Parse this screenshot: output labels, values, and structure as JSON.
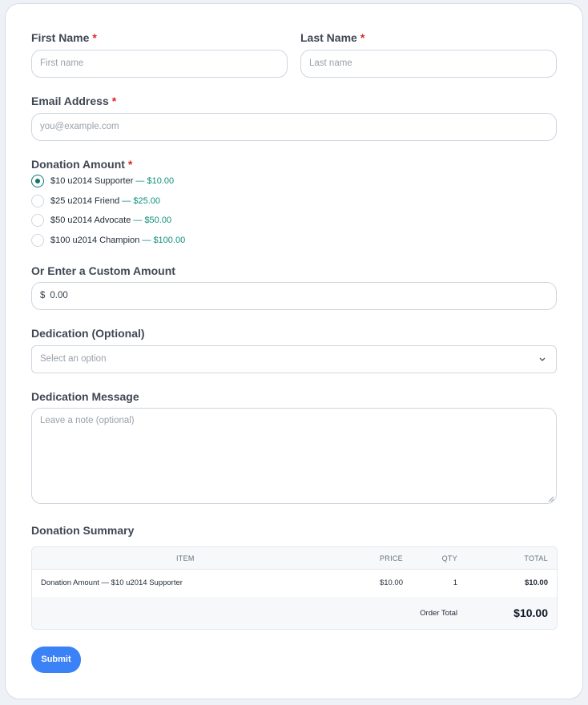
{
  "form": {
    "first_name": {
      "label": "First Name",
      "required_mark": "*",
      "placeholder": "First name"
    },
    "last_name": {
      "label": "Last Name",
      "required_mark": "*",
      "placeholder": "Last name"
    },
    "email": {
      "label": "Email Address",
      "required_mark": "*",
      "placeholder": "you@example.com"
    },
    "donation": {
      "label": "Donation Amount",
      "required_mark": "*",
      "options": [
        {
          "text": "$10 u2014 Supporter",
          "sep": " — ",
          "amount": "$10.00",
          "checked": true
        },
        {
          "text": "$25 u2014 Friend",
          "sep": " — ",
          "amount": "$25.00",
          "checked": false
        },
        {
          "text": "$50 u2014 Advocate",
          "sep": " — ",
          "amount": "$50.00",
          "checked": false
        },
        {
          "text": "$100 u2014 Champion",
          "sep": " — ",
          "amount": "$100.00",
          "checked": false
        }
      ]
    },
    "custom_amount": {
      "label": "Or Enter a Custom Amount",
      "currency": "$",
      "value": "0.00"
    },
    "dedication": {
      "label": "Dedication (Optional)",
      "selected": "Select an option"
    },
    "message": {
      "label": "Dedication Message",
      "placeholder": "Leave a note (optional)"
    },
    "summary": {
      "label": "Donation Summary",
      "columns": [
        "ITEM",
        "PRICE",
        "QTY",
        "TOTAL"
      ],
      "row": {
        "item": "Donation Amount — $10 u2014 Supporter",
        "price": "$10.00",
        "qty": "1",
        "total": "$10.00"
      },
      "order_total_label": "Order Total",
      "order_total_value": "$10.00"
    },
    "submit_label": "Submit"
  },
  "colors": {
    "accent": "#0f766e",
    "amount": "#0f8f7c",
    "required": "#dc2626",
    "button": "#3b82f6"
  }
}
